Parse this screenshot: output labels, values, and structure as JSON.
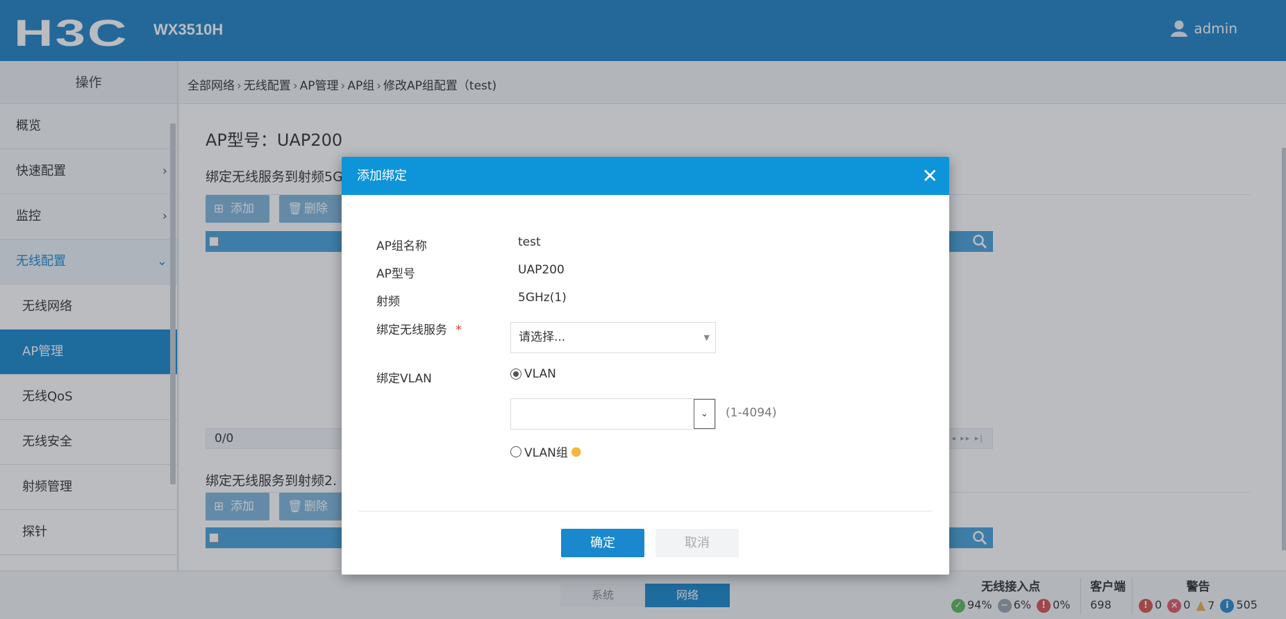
{
  "header": {
    "logo_text": "H3C",
    "model": "WX3510H",
    "username": "admin",
    "accent_color": "#2184c6"
  },
  "sidebar": {
    "title": "操作",
    "items": [
      {
        "label": "概览"
      },
      {
        "label": "快速配置",
        "chevron": "›"
      },
      {
        "label": "监控",
        "chevron": "›"
      },
      {
        "label": "无线配置",
        "chevron": "⌄"
      },
      {
        "label": "无线网络"
      },
      {
        "label": "AP管理"
      },
      {
        "label": "无线QoS"
      },
      {
        "label": "无线安全"
      },
      {
        "label": "射频管理"
      },
      {
        "label": "探针"
      }
    ]
  },
  "breadcrumb": [
    "全部网络",
    "无线配置",
    "AP管理",
    "AP组",
    "修改AP组配置（test)"
  ],
  "main": {
    "page_title": "AP型号：UAP200",
    "section1_title": "绑定无线服务到射频5G",
    "section2_title": "绑定无线服务到射频2.",
    "add_label": "添加",
    "delete_label": "删除",
    "pager_count": "0/0"
  },
  "statusbar": {
    "tabs": [
      "系统",
      "网络"
    ],
    "ap_title": "无线接入点",
    "ap_online": "94%",
    "ap_offline": "6%",
    "ap_fault": "0%",
    "client_title": "客户端",
    "client_count": "698",
    "alarm_title": "警告",
    "alarm_critical": "0",
    "alarm_major": "0",
    "alarm_minor": "7",
    "alarm_info": "505"
  },
  "modal": {
    "title": "添加绑定",
    "group_name_label": "AP组名称",
    "group_name_value": "test",
    "ap_model_label": "AP型号",
    "ap_model_value": "UAP200",
    "radio_label": "射频",
    "radio_value": "5GHz(1)",
    "service_label": "绑定无线服务",
    "required_mark": "*",
    "service_placeholder": "请选择...",
    "vlan_label": "绑定VLAN",
    "vlan_option": "VLAN",
    "vlan_range_hint": "(1-4094)",
    "vlan_group_option": "VLAN组",
    "ok_label": "确定",
    "cancel_label": "取消"
  }
}
